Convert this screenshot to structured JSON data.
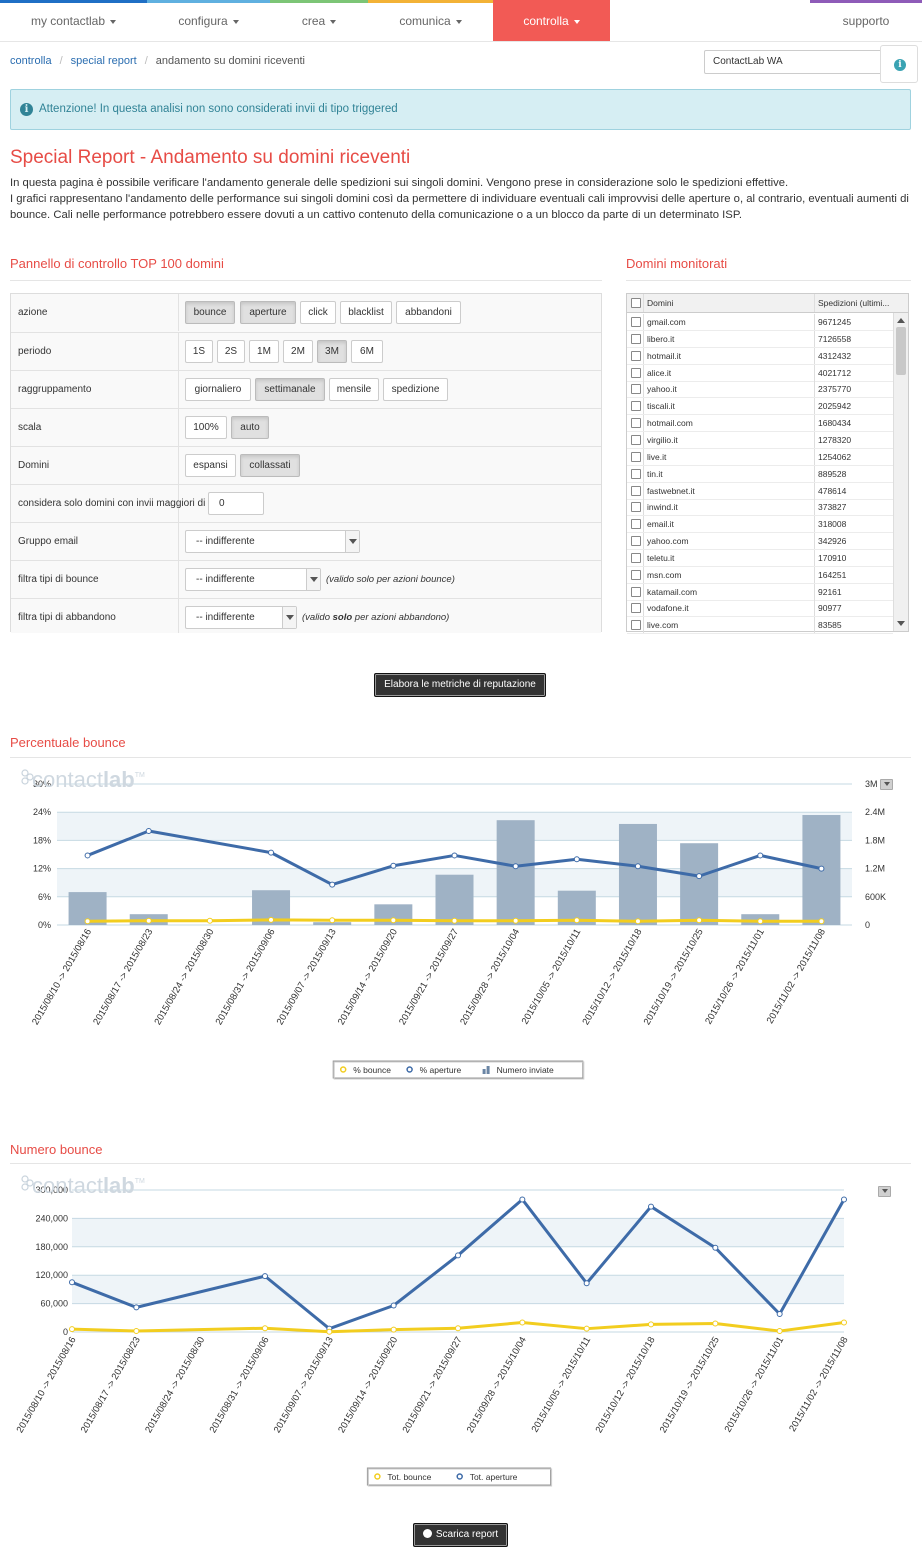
{
  "nav": {
    "items": [
      {
        "label": "my contactlab",
        "caret": true,
        "color": "#1f6fc5"
      },
      {
        "label": "configura",
        "caret": true,
        "color": "#5fb0e0"
      },
      {
        "label": "crea",
        "caret": true,
        "color": "#7cc576"
      },
      {
        "label": "comunica",
        "caret": true,
        "color": "#f3b236"
      },
      {
        "label": "controlla",
        "caret": true,
        "color": "#f25a55",
        "active": true
      }
    ],
    "support": {
      "label": "supporto",
      "color": "#8e5bb8"
    }
  },
  "breadcrumb": {
    "items": [
      "controlla",
      "special report"
    ],
    "current": "andamento su domini riceventi"
  },
  "account_select": {
    "value": "ContactLab WA"
  },
  "info_icon": "info-icon",
  "alert": {
    "text": "Attenzione! In questa analisi non sono considerati invii di tipo triggered"
  },
  "page": {
    "title": "Special Report - Andamento su domini riceventi",
    "intro_line1": "In questa pagina è possibile verificare l'andamento generale delle spedizioni sui singoli domini. Vengono prese in considerazione solo le spedizioni effettive.",
    "intro_line2": "I grafici rappresentano l'andamento delle performance sui singoli domini così da permettere di individuare eventuali cali improvvisi delle aperture o, al contrario, eventuali aumenti di bounce. Cali nelle performance potrebbero essere dovuti a un cattivo contenuto della comunicazione o a un blocco da parte di un determinato ISP."
  },
  "panel": {
    "title": "Pannello di controllo TOP 100 domini",
    "rows": {
      "azione": {
        "label": "azione",
        "buttons": [
          "bounce",
          "aperture",
          "click",
          "blacklist",
          "abbandoni"
        ],
        "selected": [
          "bounce",
          "aperture"
        ]
      },
      "periodo": {
        "label": "periodo",
        "buttons": [
          "1S",
          "2S",
          "1M",
          "2M",
          "3M",
          "6M"
        ],
        "selected": [
          "3M"
        ]
      },
      "raggruppamento": {
        "label": "raggruppamento",
        "buttons": [
          "giornaliero",
          "settimanale",
          "mensile",
          "spedizione"
        ],
        "selected": [
          "settimanale"
        ]
      },
      "scala": {
        "label": "scala",
        "buttons": [
          "100%",
          "auto"
        ],
        "selected": [
          "auto"
        ]
      },
      "domini": {
        "label": "Domini",
        "buttons": [
          "espansi",
          "collassati"
        ],
        "selected": [
          "collassati"
        ]
      },
      "min_invii": {
        "label": "considera solo domini con invii maggiori di",
        "value": "0"
      },
      "gruppo_email": {
        "label": "Gruppo email",
        "value": "-- indifferente"
      },
      "tipi_bounce": {
        "label": "filtra tipi di bounce",
        "value": "-- indifferente",
        "note": "(valido solo per azioni bounce)"
      },
      "tipi_abbandono": {
        "label": "filtra tipi di abbandono",
        "value": "-- indifferente",
        "note_pre": "(valido ",
        "note_bold": "solo",
        "note_post": " per azioni abbandono)"
      }
    }
  },
  "domains": {
    "title": "Domini monitorati",
    "headers": [
      "Domini",
      "Spedizioni (ultimi..."
    ],
    "rows": [
      {
        "name": "gmail.com",
        "value": "9671245"
      },
      {
        "name": "libero.it",
        "value": "7126558"
      },
      {
        "name": "hotmail.it",
        "value": "4312432"
      },
      {
        "name": "alice.it",
        "value": "4021712"
      },
      {
        "name": "yahoo.it",
        "value": "2375770"
      },
      {
        "name": "tiscali.it",
        "value": "2025942"
      },
      {
        "name": "hotmail.com",
        "value": "1680434"
      },
      {
        "name": "virgilio.it",
        "value": "1278320"
      },
      {
        "name": "live.it",
        "value": "1254062"
      },
      {
        "name": "tin.it",
        "value": "889528"
      },
      {
        "name": "fastwebnet.it",
        "value": "478614"
      },
      {
        "name": "inwind.it",
        "value": "373827"
      },
      {
        "name": "email.it",
        "value": "318008"
      },
      {
        "name": "yahoo.com",
        "value": "342926"
      },
      {
        "name": "teletu.it",
        "value": "170910"
      },
      {
        "name": "msn.com",
        "value": "164251"
      },
      {
        "name": "katamail.com",
        "value": "92161"
      },
      {
        "name": "vodafone.it",
        "value": "90977"
      },
      {
        "name": "live.com",
        "value": "83585"
      }
    ]
  },
  "actions": {
    "elabora": "Elabora le metriche di reputazione",
    "scarica": "Scarica report"
  },
  "chart_data": [
    {
      "type": "bar",
      "title": "Percentuale bounce",
      "watermark": {
        "light": "contact",
        "bold": "lab",
        "tm": "TM"
      },
      "categories": [
        "2015/08/10 -> 2015/08/16",
        "2015/08/17 -> 2015/08/23",
        "2015/08/24 -> 2015/08/30",
        "2015/08/31 -> 2015/09/06",
        "2015/09/07 -> 2015/09/13",
        "2015/09/14 -> 2015/09/20",
        "2015/09/21 -> 2015/09/27",
        "2015/09/28 -> 2015/10/04",
        "2015/10/05 -> 2015/10/11",
        "2015/10/12 -> 2015/10/18",
        "2015/10/19 -> 2015/10/25",
        "2015/10/26 -> 2015/11/01",
        "2015/11/02 -> 2015/11/08"
      ],
      "left_axis": {
        "ticks": [
          "0%",
          "6%",
          "12%",
          "18%",
          "24%",
          "30%"
        ],
        "ylim": [
          0,
          30
        ]
      },
      "right_axis": {
        "ticks": [
          "0",
          "600K",
          "1.2M",
          "1.8M",
          "2.4M",
          "3M"
        ],
        "ylim": [
          0,
          3000000
        ]
      },
      "series": [
        {
          "name": "% bounce",
          "kind": "line",
          "axis": "left",
          "color": "#f2cd1f",
          "values": [
            0.8,
            0.9,
            0.9,
            1.1,
            1.0,
            1.0,
            0.9,
            0.9,
            1.0,
            0.8,
            1.0,
            0.8,
            0.8
          ]
        },
        {
          "name": "% aperture",
          "kind": "line",
          "axis": "left",
          "color": "#3e6ba8",
          "values": [
            14.8,
            20.0,
            null,
            15.4,
            8.6,
            12.6,
            14.8,
            12.5,
            14.0,
            12.5,
            10.4,
            14.8,
            12.0
          ]
        },
        {
          "name": "Numero inviate",
          "kind": "bar",
          "axis": "right",
          "color": "#9fb2c5",
          "values": [
            700000,
            230000,
            0,
            740000,
            60000,
            440000,
            1070000,
            2230000,
            730000,
            2150000,
            1740000,
            230000,
            2340000
          ]
        }
      ],
      "grid": true
    },
    {
      "type": "line",
      "title": "Numero bounce",
      "watermark": {
        "light": "contact",
        "bold": "lab",
        "tm": "TM"
      },
      "categories": [
        "2015/08/10 -> 2015/08/16",
        "2015/08/17 -> 2015/08/23",
        "2015/08/24 -> 2015/08/30",
        "2015/08/31 -> 2015/09/06",
        "2015/09/07 -> 2015/09/13",
        "2015/09/14 -> 2015/09/20",
        "2015/09/21 -> 2015/09/27",
        "2015/09/28 -> 2015/10/04",
        "2015/10/05 -> 2015/10/11",
        "2015/10/12 -> 2015/10/18",
        "2015/10/19 -> 2015/10/25",
        "2015/10/26 -> 2015/11/01",
        "2015/11/02 -> 2015/11/08"
      ],
      "left_axis": {
        "ticks": [
          "0",
          "60,000",
          "120,000",
          "180,000",
          "240,000",
          "300,000"
        ],
        "ylim": [
          0,
          300000
        ]
      },
      "series": [
        {
          "name": "Tot. bounce",
          "kind": "line",
          "color": "#f2cd1f",
          "values": [
            6000,
            2000,
            null,
            8000,
            500,
            5000,
            8000,
            20000,
            7000,
            16000,
            18000,
            2000,
            20000
          ]
        },
        {
          "name": "Tot. aperture",
          "kind": "line",
          "color": "#3e6ba8",
          "values": [
            105000,
            52000,
            null,
            118000,
            7000,
            56000,
            162000,
            280000,
            103000,
            265000,
            178000,
            38000,
            280000
          ]
        }
      ],
      "grid": true
    }
  ]
}
